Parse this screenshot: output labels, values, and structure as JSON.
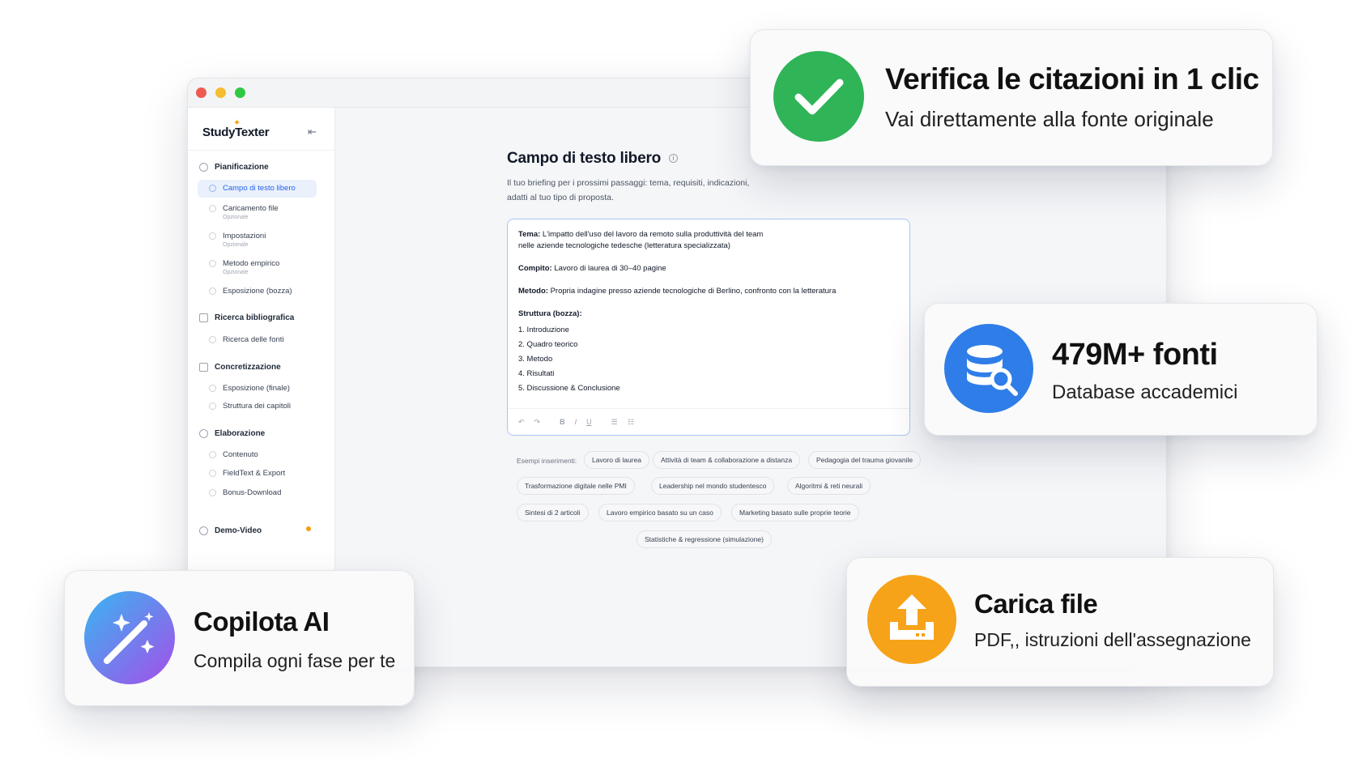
{
  "app": {
    "brand": "StudyTexter",
    "window_controls": [
      "close",
      "minimize",
      "zoom"
    ]
  },
  "sidebar": {
    "sections": [
      {
        "label": "Pianificazione",
        "icon": "target-icon"
      },
      {
        "label": "Ricerca bibliografica",
        "icon": "library-icon"
      },
      {
        "label": "Concretizzazione",
        "icon": "calendar-icon"
      },
      {
        "label": "Elaborazione",
        "icon": "pen-icon"
      },
      {
        "label": "Demo-Video",
        "icon": "play-icon"
      }
    ],
    "items": [
      {
        "label": "Campo di testo libero"
      },
      {
        "label": "Caricamento file",
        "sub": "Opzionale"
      },
      {
        "label": "Impostazioni",
        "sub": "Opzionale"
      },
      {
        "label": "Metodo empirico",
        "sub": "Opzionale"
      },
      {
        "label": "Esposizione (bozza)"
      },
      {
        "label": "Ricerca delle fonti"
      },
      {
        "label": "Esposizione (finale)"
      },
      {
        "label": "Struttura dei capitoli"
      },
      {
        "label": "Contenuto"
      },
      {
        "label": "FieldText & Export"
      },
      {
        "label": "Bonus-Download"
      }
    ],
    "active_index": 0,
    "demo_badge_color": "#f59e0b"
  },
  "main": {
    "title": "Campo di testo libero",
    "description": "Il tuo briefing per i prossimi passaggi: tema, requisiti, indicazioni, adatti al tuo tipo di proposta.",
    "editor": {
      "tema_label": "Tema:",
      "tema_line1": "L'impatto dell'uso del lavoro da remoto sulla produttività del team",
      "tema_line2": "nelle aziende tecnologiche tedesche (letteratura specializzata)",
      "compito_label": "Compito:",
      "compito": "Lavoro di laurea di 30–40 pagine",
      "metodo_label": "Metodo:",
      "metodo": "Propria indagine presso aziende tecnologiche di Berlino, confronto con la letteratura",
      "struttura_label": "Struttura (bozza):",
      "struttura": [
        "1.  Introduzione",
        "2.  Quadro teorico",
        "3.  Metodo",
        "4.  Risultati",
        "5.  Discussione & Conclusione"
      ],
      "toolbar": [
        "↶",
        "↷",
        "B",
        "I",
        "U",
        "☰",
        "☷"
      ]
    },
    "examples_label": "Esempi inserimenti:",
    "examples": [
      "Lavoro di laurea",
      "Attività di team & collaborazione a distanza",
      "Pedagogia del trauma giovanile",
      "Trasformazione digitale nelle PMI",
      "Leadership nel mondo studentesco",
      "Algoritmi & reti neurali",
      "Sintesi di 2 articoli",
      "Lavoro empirico basato su un caso",
      "Marketing basato sulle proprie teorie",
      "Statistiche & regressione (simulazione)"
    ]
  },
  "cards": {
    "citations": {
      "title": "Verifica le citazioni in 1 clic",
      "subtitle": "Vai direttamente alla fonte originale",
      "icon": "check-icon",
      "color": "#2fb457"
    },
    "sources": {
      "title": "479M+  fonti",
      "subtitle": "Database accademici",
      "icon": "database-search-icon",
      "color": "#2f7de8"
    },
    "copilot": {
      "title": "Copilota AI",
      "subtitle": "Compila ogni fase per te",
      "icon": "magic-wand-icon",
      "color_from": "#38b6f2",
      "color_to": "#a54ee8"
    },
    "upload": {
      "title": "Carica file",
      "subtitle": "PDF,, istruzioni dell'assegnazione",
      "icon": "upload-icon",
      "color": "#f6a31a"
    }
  }
}
